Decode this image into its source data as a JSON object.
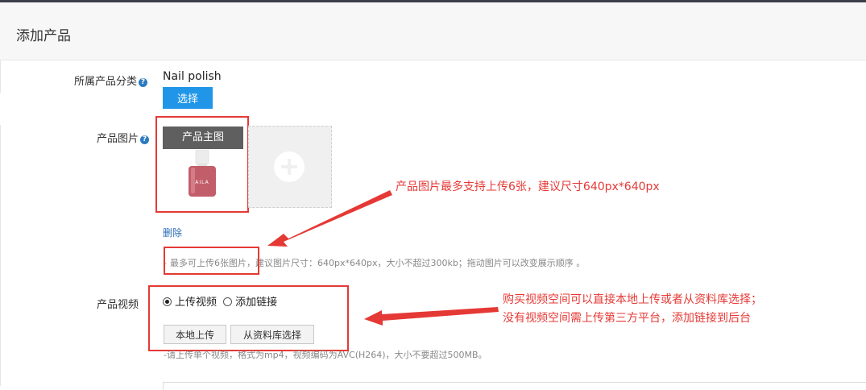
{
  "header": {
    "title": "添加产品"
  },
  "category": {
    "label": "所属产品分类",
    "value": "Nail polish",
    "select_button": "选择"
  },
  "images": {
    "label": "产品图片",
    "main_label": "产品主图",
    "bottle_brand": "AILA",
    "delete_link": "删除",
    "hint_boxed": "最多可上传6张图片",
    "hint_rest": "，建议图片尺寸：640px*640px，大小不超过300kb；拖动图片可以改变展示顺序 。",
    "annotation": "产品图片最多支持上传6张，建议尺寸640px*640px"
  },
  "video": {
    "label": "产品视频",
    "radio_upload": "上传视频",
    "radio_link": "添加链接",
    "selected": "上传视频",
    "local_upload_button": "本地上传",
    "library_button": "从资料库选择",
    "hint": "-请上传单个视频，格式为mp4，视频编码为AVC(H264)，大小不要超过500MB。",
    "annotation_line1": "购买视频空间可以直接本地上传或者从资料库选择；",
    "annotation_line2": "没有视频空间需上传第三方平台，添加链接到后台"
  },
  "colors": {
    "primary_button": "#2196e8",
    "annotation_red": "#e53935",
    "link_blue": "#2b6cb8"
  }
}
